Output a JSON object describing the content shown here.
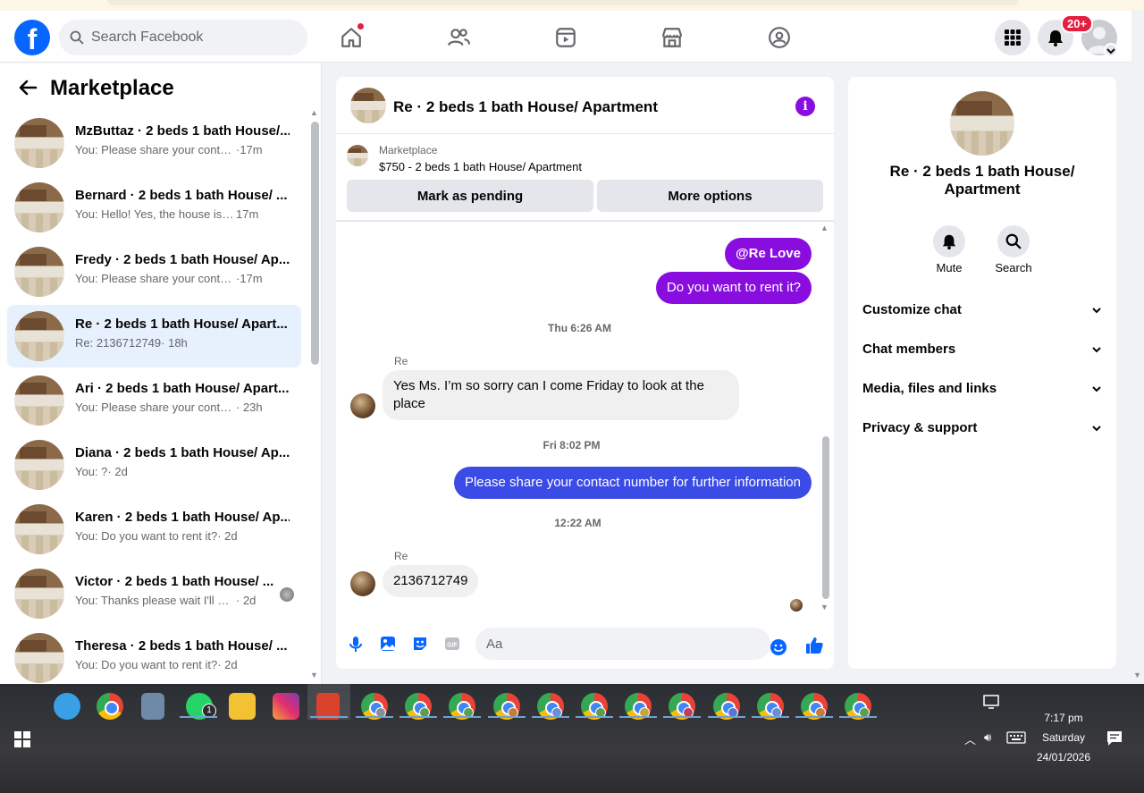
{
  "topbar": {
    "search_placeholder": "Search Facebook",
    "notif_badge": "20+"
  },
  "left": {
    "title": "Marketplace",
    "conversations": [
      {
        "name": "MzButtaz · 2 beds 1 bath House/...",
        "preview": "You: Please share your contact nu...",
        "time": "·17m"
      },
      {
        "name": "Bernard · 2 beds 1 bath House/ ...",
        "preview": "You: Hello! Yes, the house is still a...",
        "time": "17m"
      },
      {
        "name": "Fredy · 2 beds 1 bath House/ Ap...",
        "preview": "You: Please share your contact nu...",
        "time": "·17m"
      },
      {
        "name": "Re · 2 beds 1 bath House/ Apart...",
        "preview": "Re: 2136712749",
        "time": "· 18h"
      },
      {
        "name": "Ari · 2 beds 1 bath House/ Apart...",
        "preview": "You: Please share your contact nu...",
        "time": "· 23h"
      },
      {
        "name": "Diana · 2 beds 1 bath House/ Ap...",
        "preview": "You: ?",
        "time": "· 2d"
      },
      {
        "name": "Karen · 2 beds 1 bath House/ Ap...",
        "preview": "You: Do you want to rent it?",
        "time": "· 2d"
      },
      {
        "name": "Victor · 2 beds 1 bath House/ ...",
        "preview": "You: Thanks please wait I'll mess...",
        "time": "· 2d"
      },
      {
        "name": "Theresa · 2 beds 1 bath House/ ...",
        "preview": "You: Do you want to rent it?",
        "time": "· 2d"
      }
    ]
  },
  "chat": {
    "title": "Re · 2 beds 1 bath House/ Apartment",
    "market_label": "Marketplace",
    "market_price": "$750 - 2 beds 1 bath House/ Apartment",
    "btn_pending": "Mark as pending",
    "btn_more": "More options",
    "messages": {
      "m1": "@Re Love",
      "m2": "Do you want to rent it?",
      "stamp1": "Thu 6:26 AM",
      "sender1": "Re",
      "m3": "Yes Ms. I’m so sorry can I come Friday to look at the place",
      "stamp2": "Fri 8:02 PM",
      "m4": "Please share your contact number for further information",
      "stamp3": "12:22 AM",
      "sender2": "Re",
      "m5": "2136712749"
    },
    "composer_placeholder": "Aa"
  },
  "right": {
    "title": "Re · 2 beds 1 bath House/ Apartment",
    "mute": "Mute",
    "search": "Search",
    "sections": [
      "Customize chat",
      "Chat members",
      "Media, files and links",
      "Privacy & support"
    ]
  },
  "taskbar": {
    "time": "7:17 pm",
    "day": "Saturday",
    "date": "24/01/2026",
    "whatsapp_badge": "1"
  },
  "colors": {
    "fb_blue": "#0866ff",
    "accent_purple": "#8a0de0",
    "bubble_blue": "#3b4be5"
  }
}
